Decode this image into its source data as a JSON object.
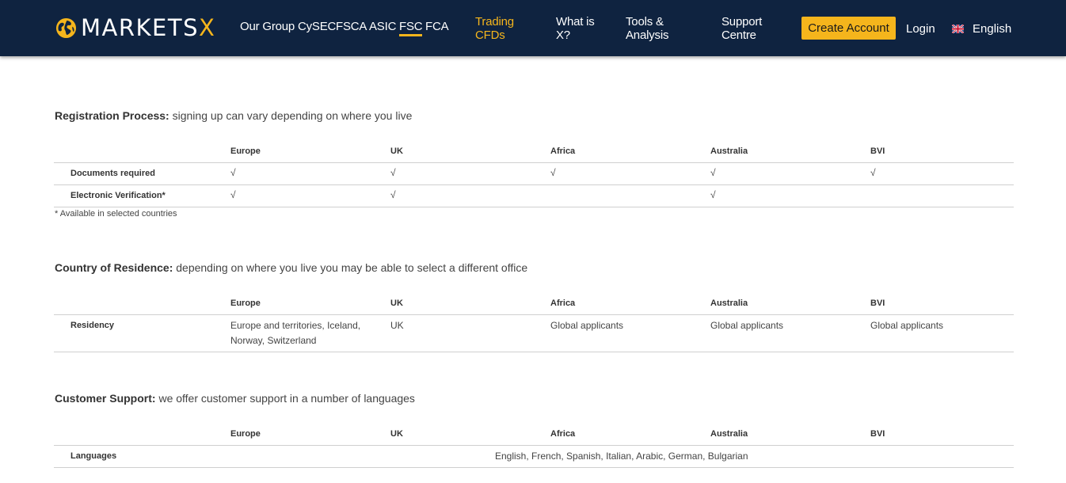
{
  "header": {
    "logo_main": "MARKETS",
    "logo_accent": "X",
    "nav": {
      "our_group": "Our Group",
      "cysec": "CySEC",
      "fsca": "FSCA",
      "asic": "ASIC",
      "fsc": "FSC",
      "fca": "FCA",
      "trading_l1": "Trading",
      "trading_l2": "CFDs",
      "whatis_l1": "What is",
      "whatis_l2": "X?",
      "tools_l1": "Tools &",
      "tools_l2": "Analysis",
      "support_l1": "Support",
      "support_l2": "Centre"
    },
    "create_account": "Create Account",
    "login": "Login",
    "language": "English",
    "colors": {
      "navy": "#0f2340",
      "gold": "#f5b51c"
    }
  },
  "columns": [
    "Europe",
    "UK",
    "Africa",
    "Australia",
    "BVI"
  ],
  "registration": {
    "title_bold": "Registration Process:",
    "title_rest": " signing up can vary depending on where you live",
    "rows": [
      {
        "label": "Documents required",
        "cells": [
          "√",
          "√",
          "√",
          "√",
          "√"
        ]
      },
      {
        "label": "Electronic Verification*",
        "cells": [
          "√",
          "√",
          "",
          "√",
          ""
        ]
      }
    ],
    "note": "* Available in selected countries"
  },
  "residence": {
    "title_bold": "Country of Residence:",
    "title_rest": " depending on where you live you may be able to select a different office",
    "row_label": "Residency",
    "europe_l1": "Europe and territories, Iceland,",
    "europe_l2": "Norway, Switzerland",
    "uk": "UK",
    "africa": "Global applicants",
    "australia": "Global applicants",
    "bvi": "Global applicants"
  },
  "support": {
    "title_bold": "Customer Support:",
    "title_rest": " we offer customer support in a number of languages",
    "row_label": "Languages",
    "value": "English, French, Spanish, Italian, Arabic, German, Bulgarian"
  }
}
